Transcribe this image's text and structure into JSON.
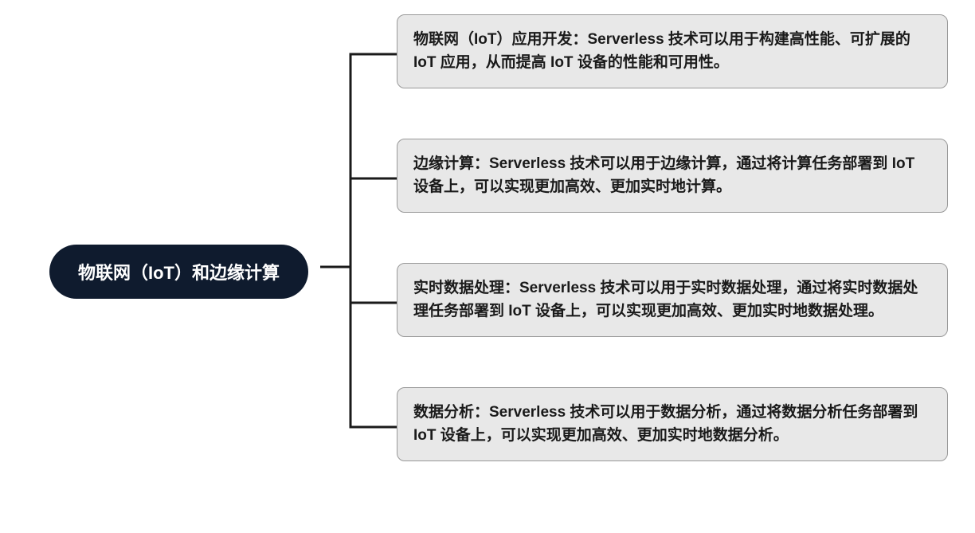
{
  "mindmap": {
    "root": {
      "label": "物联网（IoT）和边缘计算"
    },
    "children": [
      {
        "text": "物联网（IoT）应用开发：Serverless 技术可以用于构建高性能、可扩展的 IoT 应用，从而提高 IoT 设备的性能和可用性。"
      },
      {
        "text": "边缘计算：Serverless 技术可以用于边缘计算，通过将计算任务部署到 IoT 设备上，可以实现更加高效、更加实时地计算。"
      },
      {
        "text": "实时数据处理：Serverless 技术可以用于实时数据处理，通过将实时数据处理任务部署到 IoT 设备上，可以实现更加高效、更加实时地数据处理。"
      },
      {
        "text": "数据分析：Serverless 技术可以用于数据分析，通过将数据分析任务部署到 IoT 设备上，可以实现更加高效、更加实时地数据分析。"
      }
    ]
  }
}
